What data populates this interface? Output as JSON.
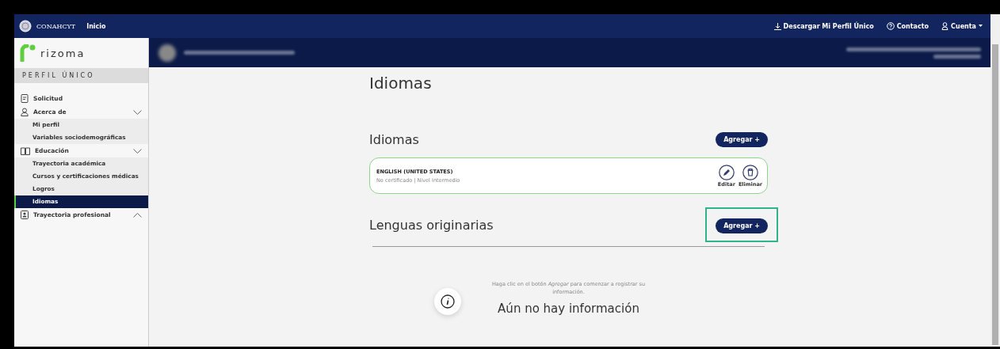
{
  "topbar": {
    "brand": "CONAHCYT",
    "home": "Inicio",
    "links": [
      {
        "kind": "download",
        "label": "Descargar Mi Perfil Único"
      },
      {
        "kind": "help",
        "label": "Contacto"
      },
      {
        "kind": "account",
        "label": "Cuenta"
      }
    ]
  },
  "sidebar": {
    "logo": "rizoma",
    "heading": "PERFIL ÚNICO",
    "items": [
      {
        "label": "Solicitud",
        "selected": false
      },
      {
        "label": "Acerca de",
        "selected": false,
        "expanded": true,
        "children": [
          {
            "label": "Mi perfil",
            "selected": false
          },
          {
            "label": "Variables sociodemográficas",
            "selected": false
          }
        ]
      },
      {
        "label": "Educación",
        "selected": false,
        "expanded": true,
        "children": [
          {
            "label": "Trayectoria académica",
            "selected": false
          },
          {
            "label": "Cursos y certificaciones médicas",
            "selected": false
          },
          {
            "label": "Logros",
            "selected": false
          },
          {
            "label": "Idiomas",
            "selected": true
          }
        ]
      },
      {
        "label": "Trayectoria profesional",
        "selected": false,
        "expanded": false
      }
    ]
  },
  "page_title": "Idiomas",
  "sections": [
    {
      "title": "Idiomas",
      "add_button": "Agregar +",
      "entries": [
        {
          "name": "ENGLISH (UNITED STATES)",
          "detail": "No certificado | Nivel Intermedio",
          "edit": "Editar",
          "delete": "Eliminar"
        }
      ]
    },
    {
      "title": "Lenguas originarias",
      "add_button": "Agregar +",
      "highlighted": true,
      "empty_hint": "Haga clic en el botón *Agregar* para comenzar a registrar su información.",
      "empty_title": "Aún no hay información"
    }
  ]
}
